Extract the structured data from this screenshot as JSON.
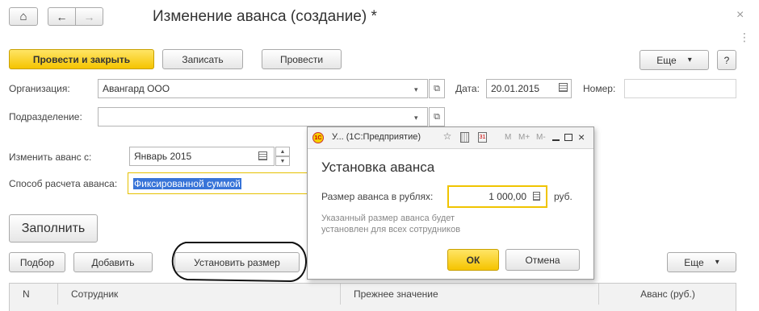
{
  "window": {
    "title": "Изменение аванса (создание) *",
    "close_glyph": "×",
    "more_glyph": "⋮"
  },
  "nav": {
    "home_glyph": "⌂",
    "back_glyph": "←",
    "forward_glyph": "→"
  },
  "toolbar": {
    "post_close_label": "Провести и закрыть",
    "save_label": "Записать",
    "post_label": "Провести",
    "more_label": "Еще",
    "dropdown_glyph": "▾",
    "help_label": "?"
  },
  "form": {
    "organization_label": "Организация:",
    "organization_value": "Авангард ООО",
    "date_label": "Дата:",
    "date_value": "20.01.2015",
    "number_label": "Номер:",
    "number_value": "",
    "department_label": "Подразделение:",
    "department_value": "",
    "change_from_label": "Изменить аванс с:",
    "change_from_value": "Январь 2015",
    "calc_method_label": "Способ расчета аванса:",
    "calc_method_value": "Фиксированной суммой"
  },
  "actions": {
    "fill_label": "Заполнить",
    "select_label": "Подбор",
    "add_label": "Добавить",
    "set_amount_label": "Установить размер",
    "more_label": "Еще"
  },
  "table": {
    "columns": [
      "N",
      "Сотрудник",
      "Прежнее значение",
      "Аванс (руб.)"
    ]
  },
  "dialog": {
    "title": "У... (1С:Предприятие)",
    "heading": "Установка аванса",
    "amount_label": "Размер аванса в рублях:",
    "amount_value": "1 000,00",
    "currency": "руб.",
    "hint": "Указанный размер аванса будет установлен для всех сотрудников",
    "ok_label": "ОК",
    "cancel_label": "Отмена",
    "toolbar_m": "M",
    "toolbar_mplus": "M+",
    "toolbar_mminus": "M-"
  }
}
